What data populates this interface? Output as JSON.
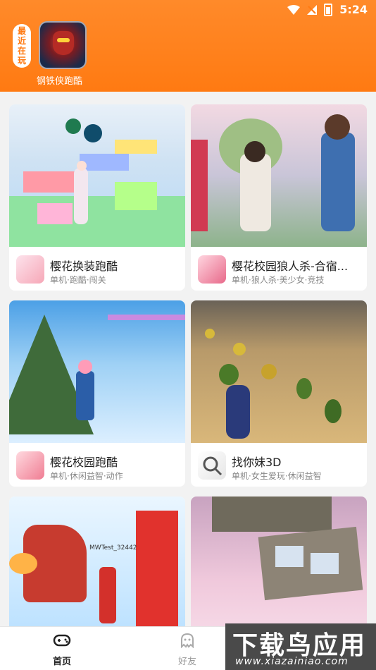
{
  "status_bar": {
    "time": "5:24"
  },
  "recent": {
    "tag_chars": [
      "最",
      "近",
      "在",
      "玩"
    ],
    "game_name": "钢铁侠跑酷"
  },
  "games": [
    {
      "name": "樱花换装跑酷",
      "tags": "单机·跑酷·闯关"
    },
    {
      "name": "樱花校园狼人杀-合宿...",
      "tags": "单机·狼人杀·美少女·竞技"
    },
    {
      "name": "樱花校园跑酷",
      "tags": "单机·休闲益智·动作"
    },
    {
      "name": "找你妹3D",
      "tags": "单机·女生爱玩·休闲益智"
    },
    {
      "name": "",
      "tags": "",
      "art_label": "MWTest_32442"
    },
    {
      "name": "",
      "tags": ""
    }
  ],
  "nav": {
    "home_label": "首页",
    "friends_label": "好友"
  },
  "watermark": {
    "title": "下载鸟应用",
    "url": "www.xiazainiao.com"
  },
  "colors": {
    "accent": "#ff7a12"
  }
}
